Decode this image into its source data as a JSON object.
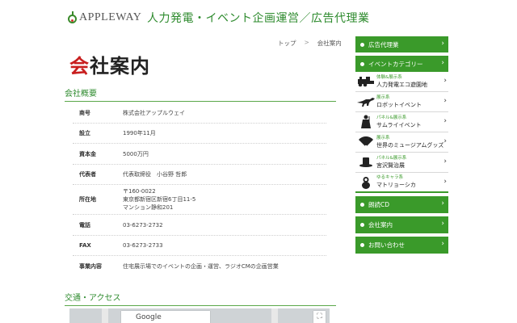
{
  "header": {
    "logo_text": "APPLEWAY",
    "tagline": "人力発電・イベント企画運営／広告代理業"
  },
  "breadcrumb": {
    "home": "トップ",
    "separator": ">",
    "current": "会社案内"
  },
  "page_title": {
    "first_char": "会",
    "rest": "社案内"
  },
  "company_section": {
    "heading": "会社概要",
    "rows": [
      {
        "key": "商号",
        "value": "株式会社アップルウェイ"
      },
      {
        "key": "設立",
        "value": "1990年11月"
      },
      {
        "key": "資本金",
        "value": "5000万円"
      },
      {
        "key": "代表者",
        "value": "代表取締役　小谷野 哲郎"
      },
      {
        "key": "所在地",
        "value": "〒160-0022\n東京都新宿区新宿6丁目11-5\nマンション静和201"
      },
      {
        "key": "電話",
        "value": "03-6273-2732"
      },
      {
        "key": "FAX",
        "value": "03-6273-2733"
      },
      {
        "key": "事業内容",
        "value": "住宅展示場でのイベントの企画・運営、ラジオCMの企画営業"
      }
    ]
  },
  "access_section": {
    "heading": "交通・アクセス",
    "map_label": "Google",
    "fullscreen_icon": "fullscreen-icon"
  },
  "sidebar": {
    "ad_agency": "広告代理業",
    "event_category": "イベントカテゴリー",
    "categories": [
      {
        "sub": "体験&展示系",
        "title": "人力発電エコ遊園地",
        "icon": "locomotive-icon"
      },
      {
        "sub": "展示系",
        "title": "ロボットイベント",
        "icon": "dinosaur-icon"
      },
      {
        "sub": "パネル&展示系",
        "title": "サムライイベント",
        "icon": "samurai-icon"
      },
      {
        "sub": "展示系",
        "title": "世界のミュージアムグッズ",
        "icon": "fan-icon"
      },
      {
        "sub": "パネル&展示系",
        "title": "宮沢賢治展",
        "icon": "hat-icon"
      },
      {
        "sub": "ゆるキャラ系",
        "title": "マトリョーシカ",
        "icon": "matryoshka-icon"
      }
    ],
    "reading_cd": "朗読CD",
    "company_info": "会社案内",
    "contact": "お問い合わせ"
  },
  "colors": {
    "brand_green": "#3a9a2a",
    "title_red": "#c81e1e",
    "tagline_green": "#2e8b2e"
  }
}
